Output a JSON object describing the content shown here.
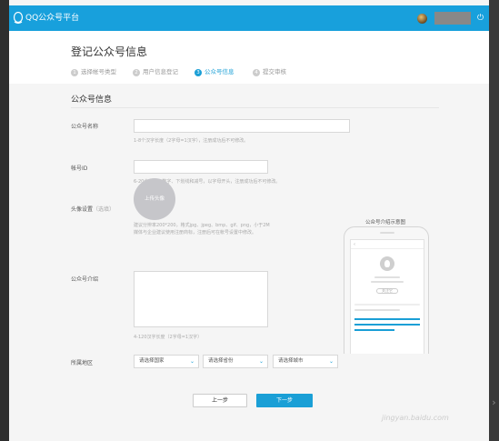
{
  "app": {
    "title": "QQ公众号平台"
  },
  "page": {
    "title": "登记公众号信息",
    "steps": [
      {
        "num": "1",
        "label": "选择帐号类型"
      },
      {
        "num": "2",
        "label": "用户信息登记"
      },
      {
        "num": "3",
        "label": "公众号信息"
      },
      {
        "num": "4",
        "label": "提交审核"
      }
    ],
    "active_step": 3
  },
  "form": {
    "section_title": "公众号信息",
    "name": {
      "label": "公众号名称",
      "hint": "1-8个汉字长度（2字母=1汉字），注册成功后不可修改。"
    },
    "account_id": {
      "label": "帐号ID",
      "hint": "6-20个字母、数字、下划线和减号，以字母开头，注册成功后不可修改。"
    },
    "avatar": {
      "label": "头像设置",
      "optional": "（选填）",
      "upload_text": "上传头像",
      "hint_line1": "建议分辨率200*200，格式jpg、jpeg、bmp、gif、png，小于2M",
      "hint_line2": "媒体与企业建议使用注册商标，注册后可在帐号设置中修改。"
    },
    "intro": {
      "label": "公众号介绍",
      "hint": "4-120汉字长度（2字母=1汉字）"
    },
    "region": {
      "label": "所属地区",
      "country": "请选择国家",
      "province": "请选择省份",
      "city": "请选择城市"
    },
    "buttons": {
      "prev": "上一步",
      "next": "下一步"
    }
  },
  "preview": {
    "title": "公众号介绍示意图",
    "follow": "关注它"
  },
  "watermark": "jingyan.baidu.com",
  "colors": {
    "topbar": "#18a0dc",
    "accent": "#1a9fd6"
  }
}
